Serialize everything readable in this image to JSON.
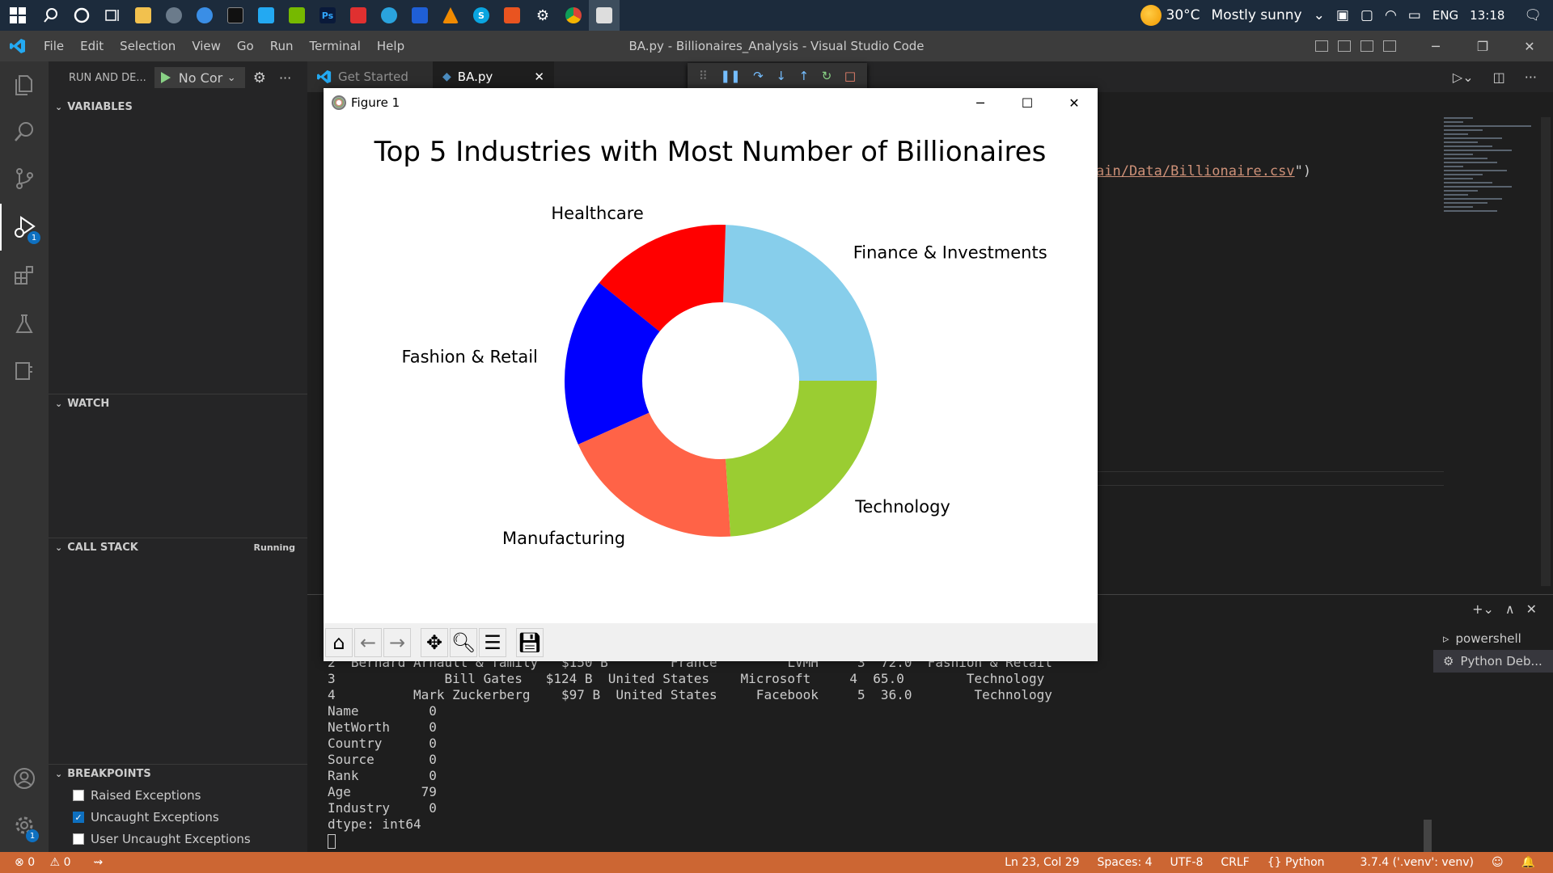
{
  "taskbar": {
    "weather_temp": "30°C",
    "weather_text": "Mostly sunny",
    "language": "ENG",
    "time": "13:18"
  },
  "titlebar": {
    "menu": [
      "File",
      "Edit",
      "Selection",
      "View",
      "Go",
      "Run",
      "Terminal",
      "Help"
    ],
    "window_title": "BA.py - Billionaires_Analysis - Visual Studio Code"
  },
  "activity": {
    "run_badge": "1",
    "settings_badge": "1"
  },
  "sidebar": {
    "run_title": "RUN AND DE...",
    "config": "No Cor",
    "sections": {
      "variables": "VARIABLES",
      "watch": "WATCH",
      "call_stack": "CALL STACK",
      "call_stack_status": "Running",
      "breakpoints": "BREAKPOINTS"
    },
    "breakpoints": [
      {
        "label": "Raised Exceptions",
        "checked": false
      },
      {
        "label": "Uncaught Exceptions",
        "checked": true
      },
      {
        "label": "User Uncaught Exceptions",
        "checked": false
      }
    ]
  },
  "tabs": [
    {
      "label": "Get Started"
    },
    {
      "label": "BA.py"
    }
  ],
  "editor": {
    "code_path": "ain/Data/Billionaire.csv",
    "code_tail": "\")"
  },
  "figure": {
    "window_title": "Figure 1"
  },
  "chart_data": {
    "type": "pie",
    "donut": true,
    "title": "Top 5 Industries with Most Number of Billionaires",
    "categories": [
      "Finance & Investments",
      "Healthcare",
      "Fashion & Retail",
      "Manufacturing",
      "Technology"
    ],
    "values": [
      24.5,
      14.7,
      17.5,
      19.3,
      24.0
    ],
    "colors": [
      "#87ceeb",
      "#ff0000",
      "#0000ff",
      "#ff6347",
      "#9acd32"
    ]
  },
  "terminal": {
    "lines": [
      "2  Bernard Arnault & family   $150 B        France         LVMH     3  72.0  Fashion & Retail",
      "3              Bill Gates   $124 B  United States    Microsoft     4  65.0        Technology",
      "4          Mark Zuckerberg    $97 B  United States     Facebook     5  36.0        Technology",
      "Name         0",
      "NetWorth     0",
      "Country      0",
      "Source       0",
      "Rank         0",
      "Age         79",
      "Industry     0",
      "dtype: int64"
    ],
    "tabs": [
      "powershell",
      "Python Deb..."
    ]
  },
  "statusbar": {
    "errors": "0",
    "warnings": "0",
    "position": "Ln 23, Col 29",
    "spaces": "Spaces: 4",
    "encoding": "UTF-8",
    "eol": "CRLF",
    "language": "Python",
    "interpreter": "3.7.4 ('.venv': venv)"
  }
}
